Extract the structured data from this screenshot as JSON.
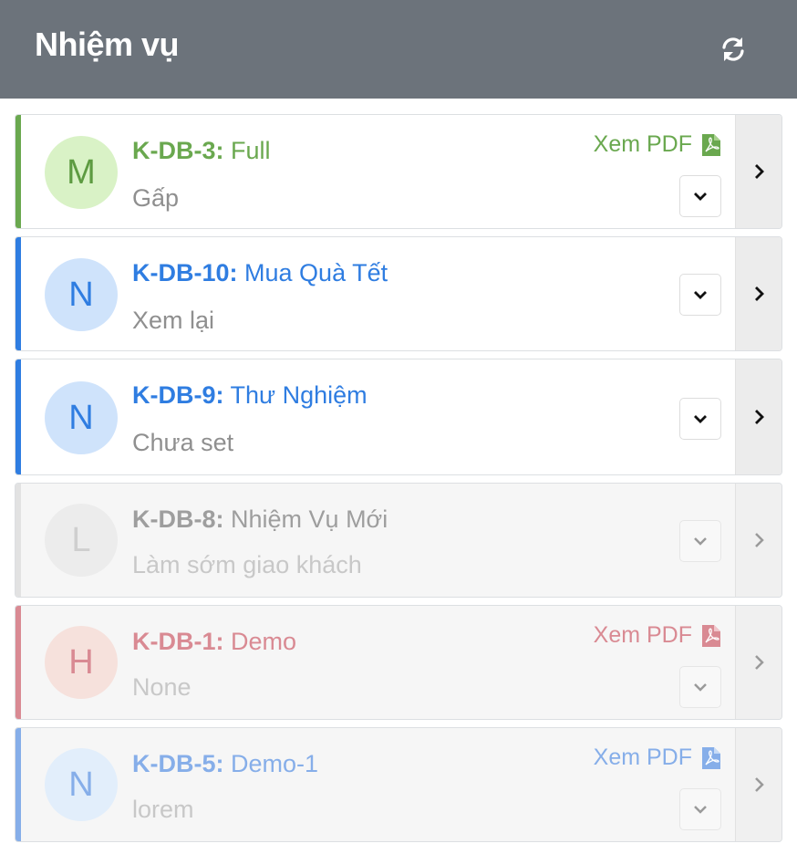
{
  "header": {
    "title": "Nhiệm vụ",
    "refresh_icon": "refresh-icon"
  },
  "colors": {
    "header_bg": "#6c737b",
    "green": "#6aa84f",
    "blue": "#2f7de1",
    "gray": "#9e9e9e",
    "red": "#d98a93",
    "light_blue": "#86aee9"
  },
  "tasks": [
    {
      "code": "K-DB-3:",
      "name": "Full",
      "avatar": "M",
      "status": "Gấp",
      "pdf_label": "Xem PDF",
      "has_pdf": true
    },
    {
      "code": "K-DB-10:",
      "name": "Mua Quà Tết",
      "avatar": "N",
      "status": "Xem lại",
      "has_pdf": false
    },
    {
      "code": "K-DB-9:",
      "name": "Thư Nghiệm",
      "avatar": "N",
      "status": "Chưa set",
      "has_pdf": false
    },
    {
      "code": "K-DB-8:",
      "name": "Nhiệm Vụ Mới",
      "avatar": "L",
      "status": "Làm sớm giao khách",
      "has_pdf": false
    },
    {
      "code": "K-DB-1:",
      "name": "Demo",
      "avatar": "H",
      "status": "None",
      "pdf_label": "Xem PDF",
      "has_pdf": true
    },
    {
      "code": "K-DB-5:",
      "name": "Demo-1",
      "avatar": "N",
      "status": "lorem",
      "pdf_label": "Xem PDF",
      "has_pdf": true
    }
  ]
}
